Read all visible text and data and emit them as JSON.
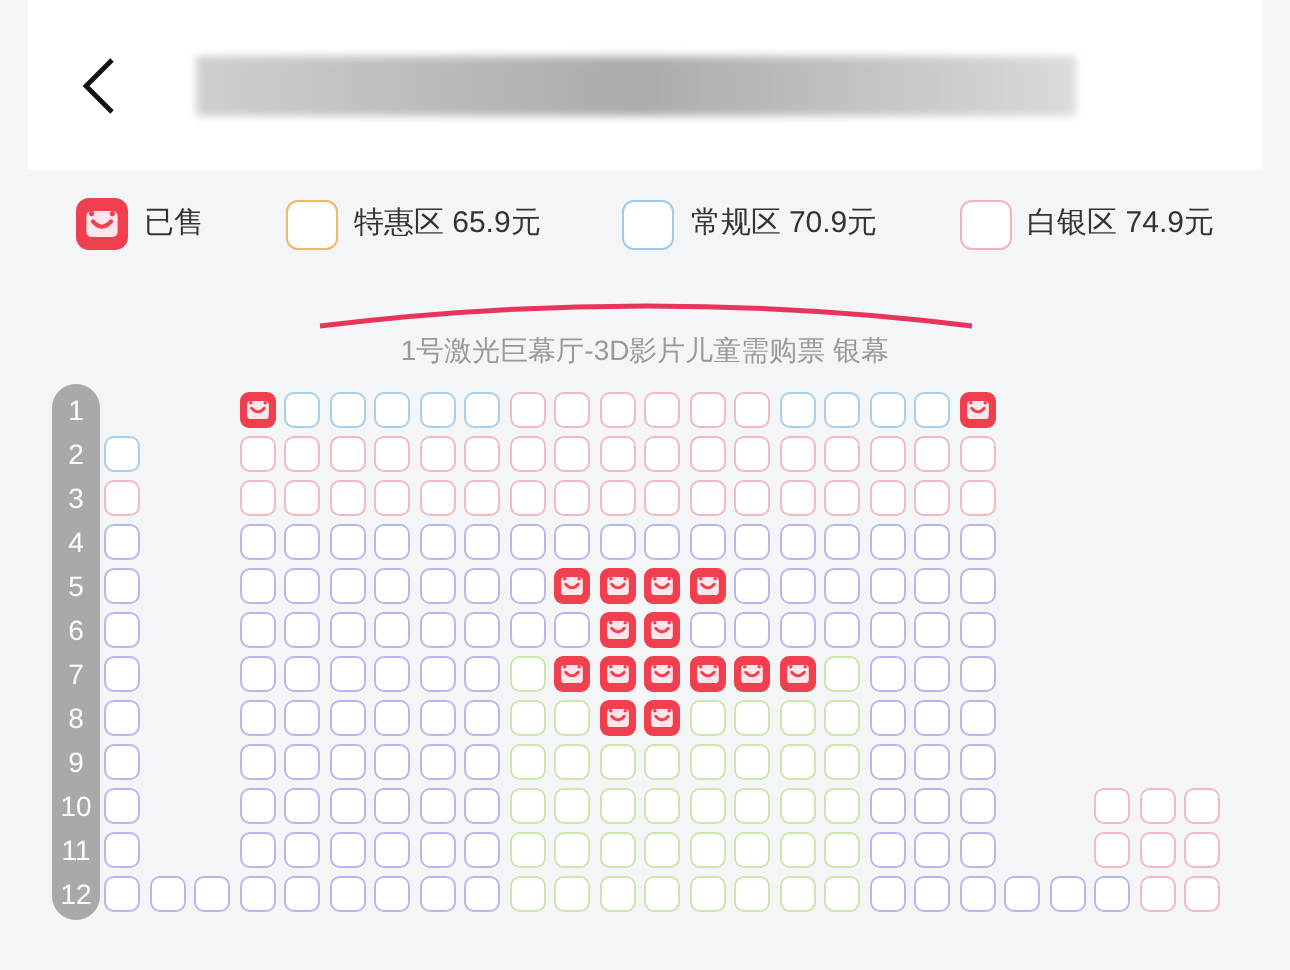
{
  "legend": [
    {
      "kind": "sold",
      "label": "已售"
    },
    {
      "kind": "zone",
      "label": "特惠区 65.9元",
      "color": "#eab96c"
    },
    {
      "kind": "zone",
      "label": "常规区 70.9元",
      "color": "#9fcaee"
    },
    {
      "kind": "zone",
      "label": "白银区 74.9元",
      "color": "#f2b3c0"
    }
  ],
  "screen": {
    "label": "1号激光巨幕厅-3D影片儿童需购票 银幕"
  },
  "rows": [
    {
      "label": "1",
      "seats": [
        {
          "kind": "gap"
        },
        {
          "kind": "gap"
        },
        {
          "kind": "gap"
        },
        {
          "kind": "sold"
        },
        {
          "kind": "seat",
          "color": "#a6cff0"
        },
        {
          "kind": "seat",
          "color": "#a6cff0"
        },
        {
          "kind": "seat",
          "color": "#a6cff0"
        },
        {
          "kind": "seat",
          "color": "#a6cff0"
        },
        {
          "kind": "seat",
          "color": "#a6cff0"
        },
        {
          "kind": "seat",
          "color": "#f2b8c4"
        },
        {
          "kind": "seat",
          "color": "#f2b8c4"
        },
        {
          "kind": "seat",
          "color": "#f2b8c4"
        },
        {
          "kind": "seat",
          "color": "#f2b8c4"
        },
        {
          "kind": "seat",
          "color": "#f2b8c4"
        },
        {
          "kind": "seat",
          "color": "#f2b8c4"
        },
        {
          "kind": "seat",
          "color": "#a6cff0"
        },
        {
          "kind": "seat",
          "color": "#a6cff0"
        },
        {
          "kind": "seat",
          "color": "#a6cff0"
        },
        {
          "kind": "seat",
          "color": "#a6cff0"
        },
        {
          "kind": "sold"
        },
        {
          "kind": "gap"
        },
        {
          "kind": "gap"
        },
        {
          "kind": "gap"
        },
        {
          "kind": "gap"
        },
        {
          "kind": "gap"
        }
      ]
    },
    {
      "label": "2",
      "seats": [
        {
          "kind": "seat",
          "color": "#a6cff0"
        },
        {
          "kind": "gap"
        },
        {
          "kind": "gap"
        },
        {
          "kind": "seat",
          "color": "#f2b8c4"
        },
        {
          "kind": "seat",
          "color": "#f2b8c4"
        },
        {
          "kind": "seat",
          "color": "#f2b8c4"
        },
        {
          "kind": "seat",
          "color": "#f2b8c4"
        },
        {
          "kind": "seat",
          "color": "#f2b8c4"
        },
        {
          "kind": "seat",
          "color": "#f2b8c4"
        },
        {
          "kind": "seat",
          "color": "#f2b8c4"
        },
        {
          "kind": "seat",
          "color": "#f2b8c4"
        },
        {
          "kind": "seat",
          "color": "#f2b8c4"
        },
        {
          "kind": "seat",
          "color": "#f2b8c4"
        },
        {
          "kind": "seat",
          "color": "#f2b8c4"
        },
        {
          "kind": "seat",
          "color": "#f2b8c4"
        },
        {
          "kind": "seat",
          "color": "#f2b8c4"
        },
        {
          "kind": "seat",
          "color": "#f2b8c4"
        },
        {
          "kind": "seat",
          "color": "#f2b8c4"
        },
        {
          "kind": "seat",
          "color": "#f2b8c4"
        },
        {
          "kind": "seat",
          "color": "#f2b8c4"
        },
        {
          "kind": "gap"
        },
        {
          "kind": "gap"
        },
        {
          "kind": "gap"
        },
        {
          "kind": "gap"
        },
        {
          "kind": "gap"
        }
      ]
    },
    {
      "label": "3",
      "seats": [
        {
          "kind": "seat",
          "color": "#f2b8c4"
        },
        {
          "kind": "gap"
        },
        {
          "kind": "gap"
        },
        {
          "kind": "seat",
          "color": "#f2b8c4"
        },
        {
          "kind": "seat",
          "color": "#f2b8c4"
        },
        {
          "kind": "seat",
          "color": "#f2b8c4"
        },
        {
          "kind": "seat",
          "color": "#f2b8c4"
        },
        {
          "kind": "seat",
          "color": "#f2b8c4"
        },
        {
          "kind": "seat",
          "color": "#f2b8c4"
        },
        {
          "kind": "seat",
          "color": "#f2b8c4"
        },
        {
          "kind": "seat",
          "color": "#f2b8c4"
        },
        {
          "kind": "seat",
          "color": "#f2b8c4"
        },
        {
          "kind": "seat",
          "color": "#f2b8c4"
        },
        {
          "kind": "seat",
          "color": "#f2b8c4"
        },
        {
          "kind": "seat",
          "color": "#f2b8c4"
        },
        {
          "kind": "seat",
          "color": "#f2b8c4"
        },
        {
          "kind": "seat",
          "color": "#f2b8c4"
        },
        {
          "kind": "seat",
          "color": "#f2b8c4"
        },
        {
          "kind": "seat",
          "color": "#f2b8c4"
        },
        {
          "kind": "seat",
          "color": "#f2b8c4"
        },
        {
          "kind": "gap"
        },
        {
          "kind": "gap"
        },
        {
          "kind": "gap"
        },
        {
          "kind": "gap"
        },
        {
          "kind": "gap"
        }
      ]
    },
    {
      "label": "4",
      "seats": [
        {
          "kind": "seat",
          "color": "#b9b5ee"
        },
        {
          "kind": "gap"
        },
        {
          "kind": "gap"
        },
        {
          "kind": "seat",
          "color": "#b9b5ee"
        },
        {
          "kind": "seat",
          "color": "#b9b5ee"
        },
        {
          "kind": "seat",
          "color": "#b9b5ee"
        },
        {
          "kind": "seat",
          "color": "#b9b5ee"
        },
        {
          "kind": "seat",
          "color": "#b9b5ee"
        },
        {
          "kind": "seat",
          "color": "#b9b5ee"
        },
        {
          "kind": "seat",
          "color": "#b9b5ee"
        },
        {
          "kind": "seat",
          "color": "#b9b5ee"
        },
        {
          "kind": "seat",
          "color": "#b9b5ee"
        },
        {
          "kind": "seat",
          "color": "#b9b5ee"
        },
        {
          "kind": "seat",
          "color": "#b9b5ee"
        },
        {
          "kind": "seat",
          "color": "#b9b5ee"
        },
        {
          "kind": "seat",
          "color": "#b9b5ee"
        },
        {
          "kind": "seat",
          "color": "#b9b5ee"
        },
        {
          "kind": "seat",
          "color": "#b9b5ee"
        },
        {
          "kind": "seat",
          "color": "#b9b5ee"
        },
        {
          "kind": "seat",
          "color": "#b9b5ee"
        },
        {
          "kind": "gap"
        },
        {
          "kind": "gap"
        },
        {
          "kind": "gap"
        },
        {
          "kind": "gap"
        },
        {
          "kind": "gap"
        }
      ]
    },
    {
      "label": "5",
      "seats": [
        {
          "kind": "seat",
          "color": "#b9b5ee"
        },
        {
          "kind": "gap"
        },
        {
          "kind": "gap"
        },
        {
          "kind": "seat",
          "color": "#b9b5ee"
        },
        {
          "kind": "seat",
          "color": "#b9b5ee"
        },
        {
          "kind": "seat",
          "color": "#b9b5ee"
        },
        {
          "kind": "seat",
          "color": "#b9b5ee"
        },
        {
          "kind": "seat",
          "color": "#b9b5ee"
        },
        {
          "kind": "seat",
          "color": "#b9b5ee"
        },
        {
          "kind": "seat",
          "color": "#b9b5ee"
        },
        {
          "kind": "sold"
        },
        {
          "kind": "sold"
        },
        {
          "kind": "sold"
        },
        {
          "kind": "sold"
        },
        {
          "kind": "seat",
          "color": "#b9b5ee"
        },
        {
          "kind": "seat",
          "color": "#b9b5ee"
        },
        {
          "kind": "seat",
          "color": "#b9b5ee"
        },
        {
          "kind": "seat",
          "color": "#b9b5ee"
        },
        {
          "kind": "seat",
          "color": "#b9b5ee"
        },
        {
          "kind": "seat",
          "color": "#b9b5ee"
        },
        {
          "kind": "gap"
        },
        {
          "kind": "gap"
        },
        {
          "kind": "gap"
        },
        {
          "kind": "gap"
        },
        {
          "kind": "gap"
        }
      ]
    },
    {
      "label": "6",
      "seats": [
        {
          "kind": "seat",
          "color": "#b9b5ee"
        },
        {
          "kind": "gap"
        },
        {
          "kind": "gap"
        },
        {
          "kind": "seat",
          "color": "#b9b5ee"
        },
        {
          "kind": "seat",
          "color": "#b9b5ee"
        },
        {
          "kind": "seat",
          "color": "#b9b5ee"
        },
        {
          "kind": "seat",
          "color": "#b9b5ee"
        },
        {
          "kind": "seat",
          "color": "#b9b5ee"
        },
        {
          "kind": "seat",
          "color": "#b9b5ee"
        },
        {
          "kind": "seat",
          "color": "#b9b5ee"
        },
        {
          "kind": "seat",
          "color": "#b9b5ee"
        },
        {
          "kind": "sold"
        },
        {
          "kind": "sold"
        },
        {
          "kind": "seat",
          "color": "#b9b5ee"
        },
        {
          "kind": "seat",
          "color": "#b9b5ee"
        },
        {
          "kind": "seat",
          "color": "#b9b5ee"
        },
        {
          "kind": "seat",
          "color": "#b9b5ee"
        },
        {
          "kind": "seat",
          "color": "#b9b5ee"
        },
        {
          "kind": "seat",
          "color": "#b9b5ee"
        },
        {
          "kind": "seat",
          "color": "#b9b5ee"
        },
        {
          "kind": "gap"
        },
        {
          "kind": "gap"
        },
        {
          "kind": "gap"
        },
        {
          "kind": "gap"
        },
        {
          "kind": "gap"
        }
      ]
    },
    {
      "label": "7",
      "seats": [
        {
          "kind": "seat",
          "color": "#b9b5ee"
        },
        {
          "kind": "gap"
        },
        {
          "kind": "gap"
        },
        {
          "kind": "seat",
          "color": "#b9b5ee"
        },
        {
          "kind": "seat",
          "color": "#b9b5ee"
        },
        {
          "kind": "seat",
          "color": "#b9b5ee"
        },
        {
          "kind": "seat",
          "color": "#b9b5ee"
        },
        {
          "kind": "seat",
          "color": "#b9b5ee"
        },
        {
          "kind": "seat",
          "color": "#b9b5ee"
        },
        {
          "kind": "seat",
          "color": "#cbe6ab"
        },
        {
          "kind": "sold"
        },
        {
          "kind": "sold"
        },
        {
          "kind": "sold"
        },
        {
          "kind": "sold"
        },
        {
          "kind": "sold"
        },
        {
          "kind": "sold"
        },
        {
          "kind": "seat",
          "color": "#cbe6ab"
        },
        {
          "kind": "seat",
          "color": "#b9b5ee"
        },
        {
          "kind": "seat",
          "color": "#b9b5ee"
        },
        {
          "kind": "seat",
          "color": "#b9b5ee"
        },
        {
          "kind": "gap"
        },
        {
          "kind": "gap"
        },
        {
          "kind": "gap"
        },
        {
          "kind": "gap"
        },
        {
          "kind": "gap"
        }
      ]
    },
    {
      "label": "8",
      "seats": [
        {
          "kind": "seat",
          "color": "#b9b5ee"
        },
        {
          "kind": "gap"
        },
        {
          "kind": "gap"
        },
        {
          "kind": "seat",
          "color": "#b9b5ee"
        },
        {
          "kind": "seat",
          "color": "#b9b5ee"
        },
        {
          "kind": "seat",
          "color": "#b9b5ee"
        },
        {
          "kind": "seat",
          "color": "#b9b5ee"
        },
        {
          "kind": "seat",
          "color": "#b9b5ee"
        },
        {
          "kind": "seat",
          "color": "#b9b5ee"
        },
        {
          "kind": "seat",
          "color": "#cbe6ab"
        },
        {
          "kind": "seat",
          "color": "#cbe6ab"
        },
        {
          "kind": "sold"
        },
        {
          "kind": "sold"
        },
        {
          "kind": "seat",
          "color": "#cbe6ab"
        },
        {
          "kind": "seat",
          "color": "#cbe6ab"
        },
        {
          "kind": "seat",
          "color": "#cbe6ab"
        },
        {
          "kind": "seat",
          "color": "#cbe6ab"
        },
        {
          "kind": "seat",
          "color": "#b9b5ee"
        },
        {
          "kind": "seat",
          "color": "#b9b5ee"
        },
        {
          "kind": "seat",
          "color": "#b9b5ee"
        },
        {
          "kind": "gap"
        },
        {
          "kind": "gap"
        },
        {
          "kind": "gap"
        },
        {
          "kind": "gap"
        },
        {
          "kind": "gap"
        }
      ]
    },
    {
      "label": "9",
      "seats": [
        {
          "kind": "seat",
          "color": "#b9b5ee"
        },
        {
          "kind": "gap"
        },
        {
          "kind": "gap"
        },
        {
          "kind": "seat",
          "color": "#b9b5ee"
        },
        {
          "kind": "seat",
          "color": "#b9b5ee"
        },
        {
          "kind": "seat",
          "color": "#b9b5ee"
        },
        {
          "kind": "seat",
          "color": "#b9b5ee"
        },
        {
          "kind": "seat",
          "color": "#b9b5ee"
        },
        {
          "kind": "seat",
          "color": "#b9b5ee"
        },
        {
          "kind": "seat",
          "color": "#cbe6ab"
        },
        {
          "kind": "seat",
          "color": "#cbe6ab"
        },
        {
          "kind": "seat",
          "color": "#cbe6ab"
        },
        {
          "kind": "seat",
          "color": "#cbe6ab"
        },
        {
          "kind": "seat",
          "color": "#cbe6ab"
        },
        {
          "kind": "seat",
          "color": "#cbe6ab"
        },
        {
          "kind": "seat",
          "color": "#cbe6ab"
        },
        {
          "kind": "seat",
          "color": "#cbe6ab"
        },
        {
          "kind": "seat",
          "color": "#b9b5ee"
        },
        {
          "kind": "seat",
          "color": "#b9b5ee"
        },
        {
          "kind": "seat",
          "color": "#b9b5ee"
        },
        {
          "kind": "gap"
        },
        {
          "kind": "gap"
        },
        {
          "kind": "gap"
        },
        {
          "kind": "gap"
        },
        {
          "kind": "gap"
        }
      ]
    },
    {
      "label": "10",
      "seats": [
        {
          "kind": "seat",
          "color": "#b9b5ee"
        },
        {
          "kind": "gap"
        },
        {
          "kind": "gap"
        },
        {
          "kind": "seat",
          "color": "#b9b5ee"
        },
        {
          "kind": "seat",
          "color": "#b9b5ee"
        },
        {
          "kind": "seat",
          "color": "#b9b5ee"
        },
        {
          "kind": "seat",
          "color": "#b9b5ee"
        },
        {
          "kind": "seat",
          "color": "#b9b5ee"
        },
        {
          "kind": "seat",
          "color": "#b9b5ee"
        },
        {
          "kind": "seat",
          "color": "#cbe6ab"
        },
        {
          "kind": "seat",
          "color": "#cbe6ab"
        },
        {
          "kind": "seat",
          "color": "#cbe6ab"
        },
        {
          "kind": "seat",
          "color": "#cbe6ab"
        },
        {
          "kind": "seat",
          "color": "#cbe6ab"
        },
        {
          "kind": "seat",
          "color": "#cbe6ab"
        },
        {
          "kind": "seat",
          "color": "#cbe6ab"
        },
        {
          "kind": "seat",
          "color": "#cbe6ab"
        },
        {
          "kind": "seat",
          "color": "#b9b5ee"
        },
        {
          "kind": "seat",
          "color": "#b9b5ee"
        },
        {
          "kind": "seat",
          "color": "#b9b5ee"
        },
        {
          "kind": "gap"
        },
        {
          "kind": "gap"
        },
        {
          "kind": "seat",
          "color": "#f2b8c4"
        },
        {
          "kind": "seat",
          "color": "#f2b8c4"
        },
        {
          "kind": "seat",
          "color": "#f2b8c4"
        }
      ]
    },
    {
      "label": "11",
      "seats": [
        {
          "kind": "seat",
          "color": "#b9b5ee"
        },
        {
          "kind": "gap"
        },
        {
          "kind": "gap"
        },
        {
          "kind": "seat",
          "color": "#b9b5ee"
        },
        {
          "kind": "seat",
          "color": "#b9b5ee"
        },
        {
          "kind": "seat",
          "color": "#b9b5ee"
        },
        {
          "kind": "seat",
          "color": "#b9b5ee"
        },
        {
          "kind": "seat",
          "color": "#b9b5ee"
        },
        {
          "kind": "seat",
          "color": "#b9b5ee"
        },
        {
          "kind": "seat",
          "color": "#cbe6ab"
        },
        {
          "kind": "seat",
          "color": "#cbe6ab"
        },
        {
          "kind": "seat",
          "color": "#cbe6ab"
        },
        {
          "kind": "seat",
          "color": "#cbe6ab"
        },
        {
          "kind": "seat",
          "color": "#cbe6ab"
        },
        {
          "kind": "seat",
          "color": "#cbe6ab"
        },
        {
          "kind": "seat",
          "color": "#cbe6ab"
        },
        {
          "kind": "seat",
          "color": "#cbe6ab"
        },
        {
          "kind": "seat",
          "color": "#b9b5ee"
        },
        {
          "kind": "seat",
          "color": "#b9b5ee"
        },
        {
          "kind": "seat",
          "color": "#b9b5ee"
        },
        {
          "kind": "gap"
        },
        {
          "kind": "gap"
        },
        {
          "kind": "seat",
          "color": "#f2b8c4"
        },
        {
          "kind": "seat",
          "color": "#f2b8c4"
        },
        {
          "kind": "seat",
          "color": "#f2b8c4"
        }
      ]
    },
    {
      "label": "12",
      "seats": [
        {
          "kind": "seat",
          "color": "#b9b5ee"
        },
        {
          "kind": "seat",
          "color": "#b9b5ee"
        },
        {
          "kind": "seat",
          "color": "#b9b5ee"
        },
        {
          "kind": "seat",
          "color": "#b9b5ee"
        },
        {
          "kind": "seat",
          "color": "#b9b5ee"
        },
        {
          "kind": "seat",
          "color": "#b9b5ee"
        },
        {
          "kind": "seat",
          "color": "#b9b5ee"
        },
        {
          "kind": "seat",
          "color": "#b9b5ee"
        },
        {
          "kind": "seat",
          "color": "#b9b5ee"
        },
        {
          "kind": "seat",
          "color": "#cbe6ab"
        },
        {
          "kind": "seat",
          "color": "#cbe6ab"
        },
        {
          "kind": "seat",
          "color": "#cbe6ab"
        },
        {
          "kind": "seat",
          "color": "#cbe6ab"
        },
        {
          "kind": "seat",
          "color": "#cbe6ab"
        },
        {
          "kind": "seat",
          "color": "#cbe6ab"
        },
        {
          "kind": "seat",
          "color": "#cbe6ab"
        },
        {
          "kind": "seat",
          "color": "#cbe6ab"
        },
        {
          "kind": "seat",
          "color": "#b9b5ee"
        },
        {
          "kind": "seat",
          "color": "#b9b5ee"
        },
        {
          "kind": "seat",
          "color": "#b9b5ee"
        },
        {
          "kind": "seat",
          "color": "#b9b5ee"
        },
        {
          "kind": "seat",
          "color": "#b9b5ee"
        },
        {
          "kind": "seat",
          "color": "#b9b5ee"
        },
        {
          "kind": "seat",
          "color": "#f2b8c4"
        },
        {
          "kind": "seat",
          "color": "#f2b8c4"
        }
      ]
    }
  ]
}
